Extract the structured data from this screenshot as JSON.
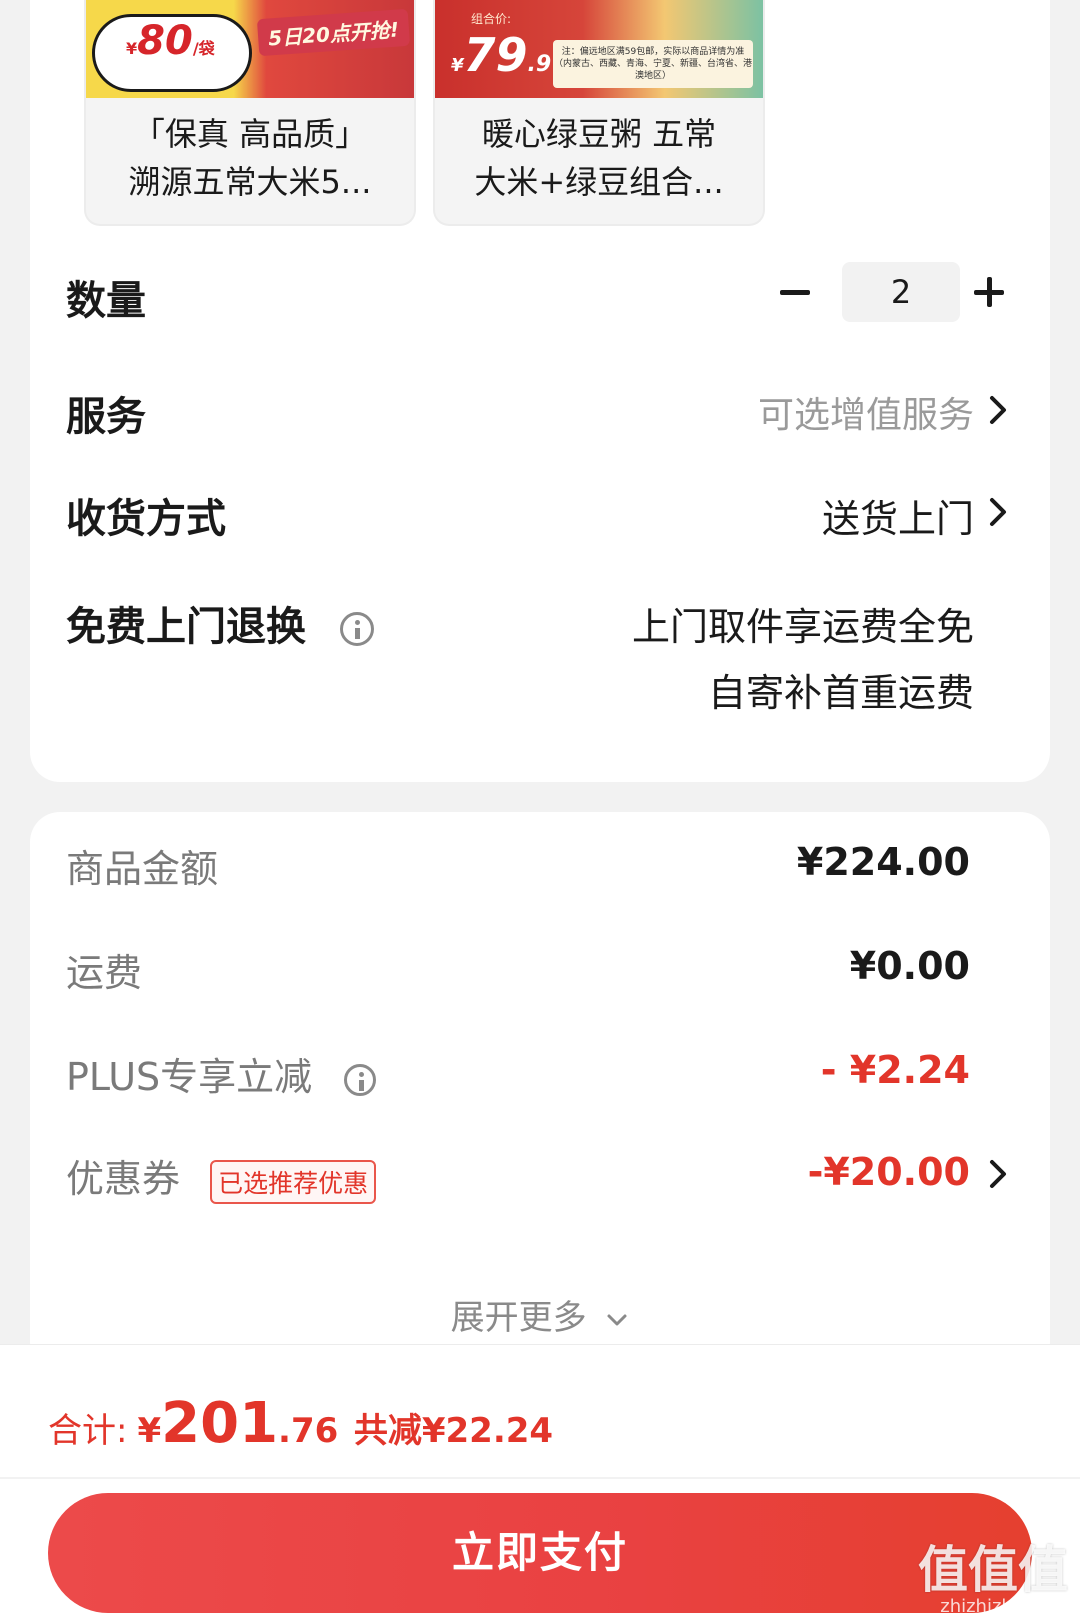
{
  "bundles": [
    {
      "price_prefix": "¥",
      "price": "80",
      "price_unit": "/袋",
      "promo": "5日20点开抢!",
      "title_line1": "「保真 高品质」",
      "title_line2": "溯源五常大米5..."
    },
    {
      "badge": "组合价:",
      "price_prefix": "¥",
      "price": "79",
      "price_decimal": ".9",
      "note": "注：偏远地区满59包邮，实际以商品详情为准（内蒙古、西藏、青海、宁夏、新疆、台湾省、港澳地区）",
      "title_line1": "暖心绿豆粥 五常",
      "title_line2": "大米+绿豆组合..."
    }
  ],
  "quantity": {
    "label": "数量",
    "value": "2"
  },
  "service": {
    "label": "服务",
    "value": "可选增值服务"
  },
  "delivery": {
    "label": "收货方式",
    "value": "送货上门"
  },
  "free_return": {
    "label": "免费上门退换",
    "line1": "上门取件享运费全免",
    "line2": "自寄补首重运费"
  },
  "price_rows": {
    "goods": {
      "label": "商品金额",
      "value": "¥224.00"
    },
    "shipping": {
      "label": "运费",
      "value": "¥0.00"
    },
    "plus": {
      "label": "PLUS专享立减",
      "value": "- ¥2.24"
    },
    "coupon": {
      "label": "优惠券",
      "tag": "已选推荐优惠",
      "value": "-¥20.00"
    }
  },
  "expand_label": "展开更多",
  "total": {
    "label": "合计:",
    "currency": "¥",
    "integer": "201",
    "decimal": ".76",
    "saved": "共减¥22.24"
  },
  "pay_button": "立即支付",
  "watermark": {
    "main": "值值值",
    "sub": "zhizhizhi.com"
  },
  "colors": {
    "accent_red": "#e2352a",
    "pay_button": "#e94141"
  }
}
